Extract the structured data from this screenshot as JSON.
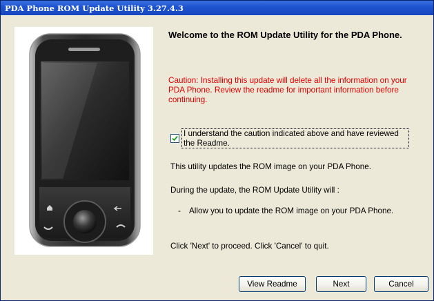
{
  "window": {
    "title": "PDA Phone ROM Update Utility 3.27.4.3"
  },
  "content": {
    "heading": "Welcome to the ROM Update Utility for the PDA Phone.",
    "caution": "Caution: Installing this update will delete all the information on your PDA Phone. Review the readme for important information before continuing.",
    "agree_checkbox": {
      "label": "I understand the caution indicated above and have reviewed the Readme.",
      "checked": true
    },
    "info_line": "This utility updates the ROM image on your PDA Phone.",
    "during_update": "During the update, the ROM Update Utility will :",
    "bullet_marker": "-",
    "bullet_text": "Allow you to update the ROM image on your PDA Phone.",
    "instruction": "Click 'Next' to proceed. Click 'Cancel' to quit."
  },
  "buttons": {
    "view_readme": "View Readme",
    "next": "Next",
    "cancel": "Cancel"
  },
  "colors": {
    "title_bar": "#1f55d0",
    "caution_text": "#e00000",
    "dialog_bg": "#ece9d8"
  },
  "icons": {
    "phone_image": "pda-phone-image",
    "checkmark": "checkmark-icon"
  }
}
